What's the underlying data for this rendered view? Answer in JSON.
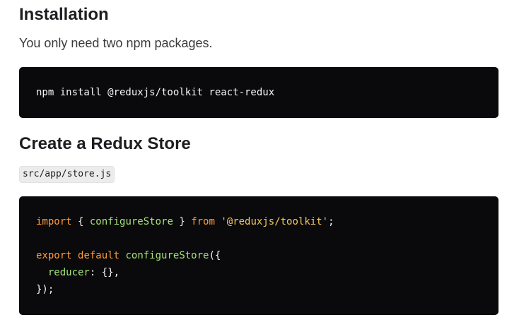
{
  "installation": {
    "heading": "Installation",
    "intro": "You only need two npm packages.",
    "command": "npm install @reduxjs/toolkit react-redux"
  },
  "store": {
    "heading": "Create a Redux Store",
    "file_path": "src/app/store.js",
    "code": {
      "line1": {
        "kw_import": "import",
        "brace_open": " { ",
        "fn_configure": "configureStore",
        "brace_close": " } ",
        "kw_from": "from",
        "space": " ",
        "module": "'@reduxjs/toolkit'",
        "semi": ";"
      },
      "line3": {
        "kw_export": "export",
        "space1": " ",
        "kw_default": "default",
        "space2": " ",
        "fn_configure": "configureStore",
        "paren": "({"
      },
      "line4": {
        "indent": "  ",
        "prop_reducer": "reducer",
        "rest": ": {},"
      },
      "line5": {
        "close": "});"
      }
    }
  },
  "colors": {
    "code_background": "#0a0a0c",
    "keyword": "#ff9d3a",
    "identifier": "#a6e37a",
    "string": "#f7c95c"
  }
}
